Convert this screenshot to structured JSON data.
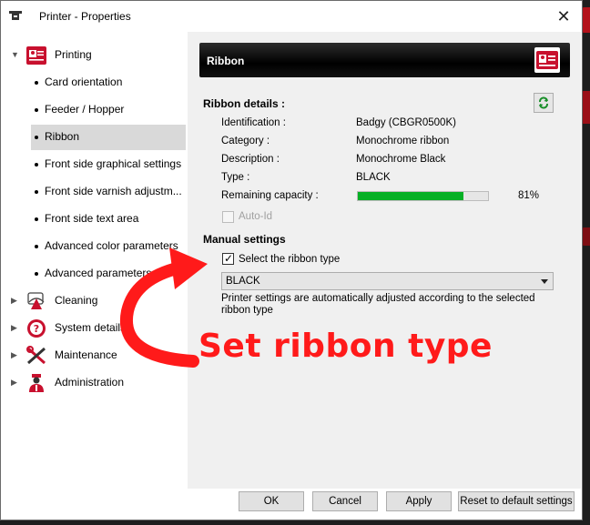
{
  "window": {
    "title": "Printer  - Properties",
    "close_glyph": "✕"
  },
  "tree": {
    "printing": {
      "label": "Printing",
      "arrow": "▼"
    },
    "printing_items": [
      {
        "label": "Card orientation"
      },
      {
        "label": "Feeder / Hopper"
      },
      {
        "label": "Ribbon",
        "selected": true
      },
      {
        "label": "Front side graphical settings"
      },
      {
        "label": "Front side varnish adjustm..."
      },
      {
        "label": "Front side text area"
      },
      {
        "label": "Advanced color parameters"
      },
      {
        "label": "Advanced parameters"
      }
    ],
    "others": [
      {
        "label": "Cleaning",
        "arrow": "▶",
        "icon": "cleaning-icon"
      },
      {
        "label": "System details",
        "arrow": "▶",
        "icon": "help-icon"
      },
      {
        "label": "Maintenance",
        "arrow": "▶",
        "icon": "tools-icon"
      },
      {
        "label": "Administration",
        "arrow": "▶",
        "icon": "admin-icon"
      }
    ]
  },
  "panel": {
    "header": "Ribbon",
    "details_title": "Ribbon details :",
    "details": [
      {
        "label": "Identification :",
        "value": "Badgy (CBGR0500K)"
      },
      {
        "label": "Category :",
        "value": "Monochrome ribbon"
      },
      {
        "label": "Description :",
        "value": "Monochrome Black"
      },
      {
        "label": "Type :",
        "value": "BLACK"
      },
      {
        "label": "Remaining capacity :",
        "value": ""
      }
    ],
    "remaining_capacity_fraction": 0.81,
    "remaining_capacity_text": "81%",
    "auto_id_label": "Auto-Id",
    "manual_title": "Manual settings",
    "select_type_label": "Select the ribbon  type",
    "select_type_checked": true,
    "ribbon_type_value": "BLACK",
    "note": "Printer settings are automatically adjusted according to the selected ribbon type"
  },
  "buttons": {
    "ok": "OK",
    "cancel": "Cancel",
    "apply": "Apply",
    "reset": "Reset to default settings"
  },
  "annotation": {
    "text": "Set ribbon type",
    "color": "#ff1a1a"
  },
  "colors": {
    "progress": "#06b025",
    "brand_red": "#c8102e"
  }
}
